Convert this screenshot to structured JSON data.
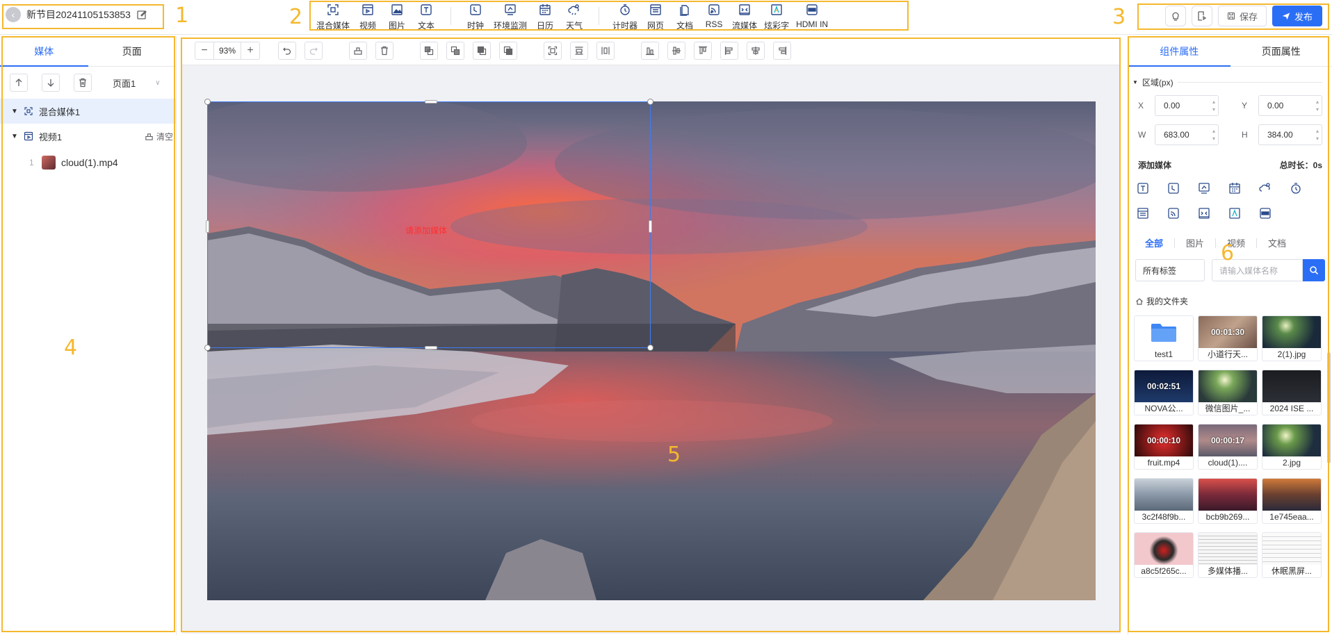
{
  "program": {
    "name": "新节目20241105153853"
  },
  "toolbar": {
    "tools": [
      "混合媒体",
      "视频",
      "图片",
      "文本",
      "时钟",
      "环境监测",
      "日历",
      "天气",
      "计时器",
      "网页",
      "文档",
      "RSS",
      "流媒体",
      "炫彩字",
      "HDMI IN"
    ]
  },
  "actions": {
    "save_label": "保存",
    "publish_label": "发布"
  },
  "left_panel": {
    "tabs": [
      "媒体",
      "页面"
    ],
    "page_select": "页面1",
    "tree": {
      "mix_label": "混合媒体1",
      "video_label": "视频1",
      "clear_label": "清空",
      "media_index": "1",
      "media_file": "cloud(1).mp4"
    }
  },
  "canvas": {
    "zoom": "93%",
    "placeholder": "请添加媒体"
  },
  "right_panel": {
    "tabs": [
      "组件属性",
      "页面属性"
    ],
    "region_title": "区域(px)",
    "fields": {
      "x_label": "X",
      "x": "0.00",
      "y_label": "Y",
      "y": "0.00",
      "w_label": "W",
      "w": "683.00",
      "h_label": "H",
      "h": "384.00"
    },
    "add_media_label": "添加媒体",
    "duration_label": "总时长：",
    "duration_value": "0s",
    "filter_tabs": [
      "全部",
      "图片",
      "视频",
      "文档"
    ],
    "tag_select": "所有标签",
    "search_placeholder": "请输入媒体名称",
    "folder_label": "我的文件夹",
    "media": [
      {
        "name": "test1",
        "duration": ""
      },
      {
        "name": "小道行天...",
        "duration": "00:01:30"
      },
      {
        "name": "2(1).jpg",
        "duration": ""
      },
      {
        "name": "NOVA公...",
        "duration": "00:02:51"
      },
      {
        "name": "微信图片_...",
        "duration": ""
      },
      {
        "name": "2024 ISE ...",
        "duration": ""
      },
      {
        "name": "fruit.mp4",
        "duration": "00:00:10"
      },
      {
        "name": "cloud(1)....",
        "duration": "00:00:17"
      },
      {
        "name": "2.jpg",
        "duration": ""
      },
      {
        "name": "3c2f48f9b...",
        "duration": ""
      },
      {
        "name": "bcb9b269...",
        "duration": ""
      },
      {
        "name": "1e745eaa...",
        "duration": ""
      },
      {
        "name": "a8c5f265c...",
        "duration": ""
      },
      {
        "name": "多媒体播...",
        "duration": ""
      },
      {
        "name": "休眠黑屏...",
        "duration": ""
      }
    ]
  },
  "annotations": [
    "1",
    "2",
    "3",
    "4",
    "5",
    "6"
  ],
  "colors": {
    "accent": "#2b6ef6",
    "annotation": "#f5b82e",
    "hint": "#ff3030"
  }
}
